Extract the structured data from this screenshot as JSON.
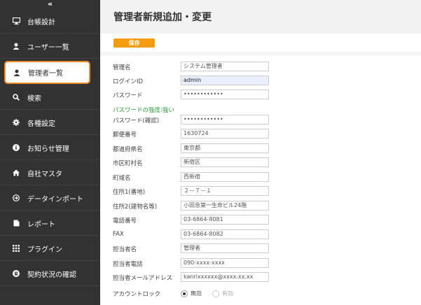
{
  "sidebar": {
    "collapse_glyph": "«",
    "items": [
      {
        "label": "台帳設計",
        "icon": "monitor-icon"
      },
      {
        "label": "ユーザー一覧",
        "icon": "user-icon"
      },
      {
        "label": "管理者一覧",
        "icon": "user-icon"
      },
      {
        "label": "検索",
        "icon": "search-icon"
      },
      {
        "label": "各種設定",
        "icon": "gear-icon"
      },
      {
        "label": "お知らせ管理",
        "icon": "info-icon"
      },
      {
        "label": "自社マスタ",
        "icon": "home-icon"
      },
      {
        "label": "データインポート",
        "icon": "import-icon"
      },
      {
        "label": "レポート",
        "icon": "document-icon"
      },
      {
        "label": "プラグイン",
        "icon": "grid-icon"
      },
      {
        "label": "契約状況の確認",
        "icon": "contract-icon"
      }
    ]
  },
  "page": {
    "title": "管理者新規追加・変更"
  },
  "toolbar": {
    "save_label": "保存"
  },
  "form": {
    "fields": [
      {
        "label": "管理名",
        "value": "システム管理者"
      },
      {
        "label": "ログインID",
        "value": "admin"
      },
      {
        "label": "パスワード",
        "value": "••••••••••••"
      },
      {
        "label": "パスワード(確認)",
        "value": "••••••••••••"
      },
      {
        "label": "郵便番号",
        "value": "1630724"
      },
      {
        "label": "都道府県名",
        "value": "東京都"
      },
      {
        "label": "市区町村名",
        "value": "新宿区"
      },
      {
        "label": "町域名",
        "value": "西新宿"
      },
      {
        "label": "住所1(番地)",
        "value": "２－７－１"
      },
      {
        "label": "住所2(建物名等)",
        "value": "小田急第一生命ビル24階"
      },
      {
        "label": "電話番号",
        "value": "03-6864-8081"
      },
      {
        "label": "FAX",
        "value": "03-6864-8082"
      },
      {
        "label": "担当者名",
        "value": "管理者"
      },
      {
        "label": "担当者電話",
        "value": "090-xxxx-xxxx"
      },
      {
        "label": "担当者メールアドレス",
        "value": "kanrixxxxxx@xxxx.xx.xx"
      }
    ],
    "password_strength": "パスワードの強度:強い",
    "account_lock": {
      "label": "アカウントロック",
      "options": [
        "無効",
        "有効"
      ],
      "selected": "無効"
    }
  },
  "colors": {
    "sidebar_bg": "#323232",
    "accent_orange": "#f39c12",
    "active_border": "#ee8a2c",
    "strength_green": "#2e9c3a"
  }
}
